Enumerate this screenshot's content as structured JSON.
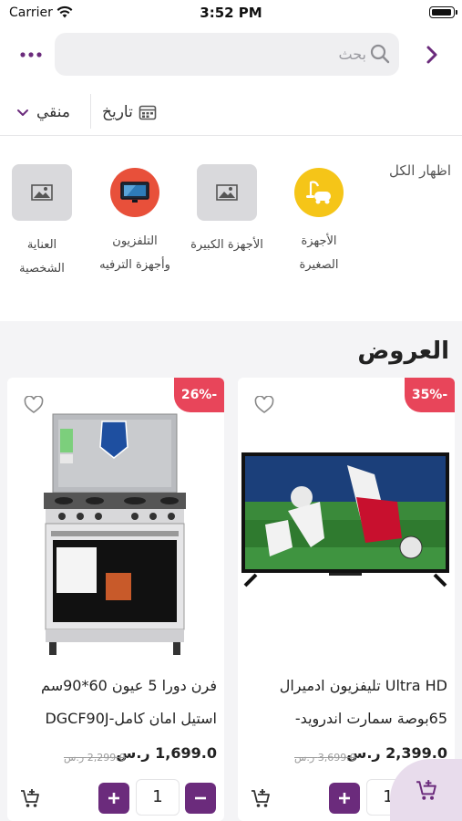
{
  "status_bar": {
    "carrier": "Carrier",
    "time": "3:52 PM"
  },
  "header": {
    "search_placeholder": "بحث"
  },
  "filters": {
    "sort_label": "منقي",
    "date_label": "تاريخ"
  },
  "categories": {
    "show_all": "اظهار الكل",
    "items": [
      {
        "label": "الأجهزة الصغيرة",
        "icon": "vacuum-cleaner-icon",
        "color": "#f5c518"
      },
      {
        "label": "الأجهزة الكبيرة",
        "icon": "image-placeholder-icon"
      },
      {
        "label": "التلفزيون وأجهزة الترفيه",
        "icon": "tv-icon",
        "color": "#e8503a"
      },
      {
        "label": "العناية الشخصية",
        "icon": "image-placeholder-icon"
      }
    ]
  },
  "offers": {
    "title": "العروض",
    "products": [
      {
        "name": "Ultra HD تليفزيون ادميرال 65بوصة سمارت اندرويد-",
        "discount": "35%-",
        "price": "2,399.0 ر.س",
        "old_price": "3,699.0 ر.س",
        "qty": "1"
      },
      {
        "name": "فرن دورا 5 عيون 60*90سم استيل امان كامل-DGCF90J",
        "discount": "26%-",
        "price": "1,699.0 ر.س",
        "old_price": "2,299.0 ر.س",
        "qty": "1"
      }
    ]
  },
  "colors": {
    "accent": "#6b2b7c",
    "discount": "#e8455a"
  }
}
